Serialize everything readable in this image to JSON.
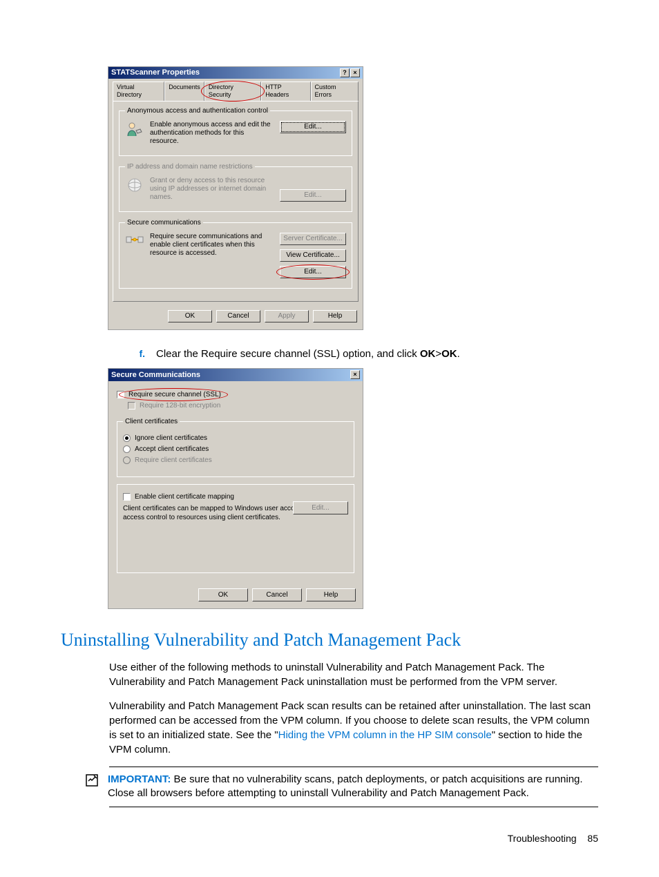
{
  "dialog1": {
    "title": "STATScanner Properties",
    "help_btn": "?",
    "close_btn": "×",
    "tabs": [
      "Virtual Directory",
      "Documents",
      "Directory Security",
      "HTTP Headers",
      "Custom Errors"
    ],
    "groups": {
      "auth": {
        "legend": "Anonymous access and authentication control",
        "desc": "Enable anonymous access and edit the authentication methods for this resource.",
        "edit": "Edit..."
      },
      "ip": {
        "legend": "IP address and domain name restrictions",
        "desc": "Grant or deny access to this resource using IP addresses or internet domain names.",
        "edit": "Edit..."
      },
      "secure": {
        "legend": "Secure communications",
        "desc": "Require secure communications and enable client certificates when this resource is accessed.",
        "server_cert": "Server Certificate...",
        "view_cert": "View Certificate...",
        "edit": "Edit..."
      }
    },
    "buttons": {
      "ok": "OK",
      "cancel": "Cancel",
      "apply": "Apply",
      "help": "Help"
    }
  },
  "step_f": {
    "label": "f.",
    "text_before": "Clear the Require secure channel (SSL) option, and click ",
    "ok": "OK",
    "gt": ">",
    "ok2": "OK",
    "period": "."
  },
  "dialog2": {
    "title": "Secure Communications",
    "close_btn": "×",
    "require_ssl": "Require secure channel (SSL)",
    "require_128": "Require 128-bit encryption",
    "client_certs": {
      "legend": "Client certificates",
      "ignore": "Ignore client certificates",
      "accept": "Accept client certificates",
      "require": "Require client certificates"
    },
    "mapping": {
      "enable": "Enable client certificate mapping",
      "desc": "Client certificates can be mapped to Windows user accounts.  This allows access control to resources using client certificates.",
      "edit": "Edit..."
    },
    "buttons": {
      "ok": "OK",
      "cancel": "Cancel",
      "help": "Help"
    }
  },
  "heading": "Uninstalling Vulnerability and Patch Management Pack",
  "para1": "Use either of the following methods to uninstall Vulnerability and Patch Management Pack. The Vulnerability and Patch Management Pack uninstallation must be performed from the VPM server.",
  "para2_a": "Vulnerability and Patch Management Pack scan results can be retained after uninstallation. The last scan performed can be accessed from the VPM column. If you choose to delete scan results, the VPM column is set to an initialized state. See the \"",
  "para2_link": "Hiding the VPM column in the HP SIM console",
  "para2_b": "\" section to hide the VPM column.",
  "important": {
    "label": "IMPORTANT:",
    "text": " Be sure that no vulnerability scans, patch deployments, or patch acquisitions are running. Close all browsers before attempting to uninstall Vulnerability and Patch Management Pack."
  },
  "footer": {
    "section": "Troubleshooting",
    "page": "85"
  }
}
